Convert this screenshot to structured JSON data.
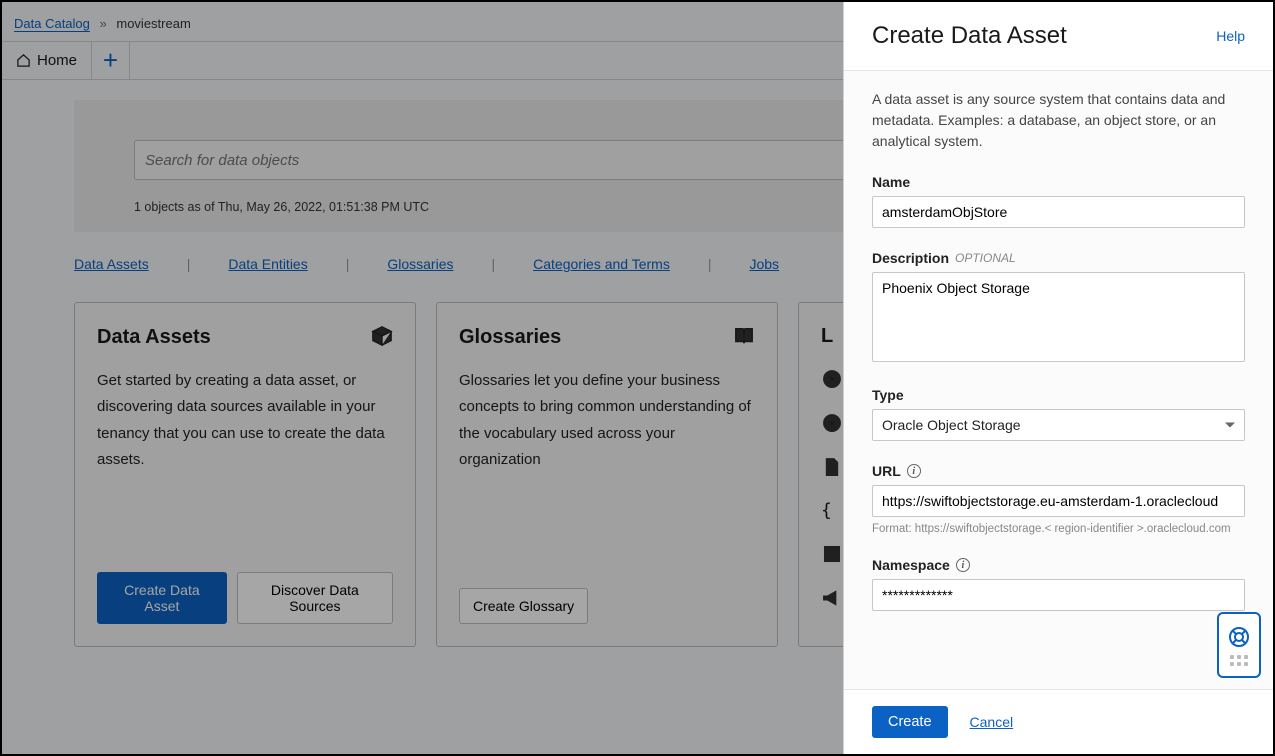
{
  "breadcrumb": {
    "root": "Data Catalog",
    "current": "moviestream"
  },
  "tabs": {
    "home": "Home"
  },
  "search": {
    "placeholder": "Search for data objects",
    "meta": "1 objects as of Thu, May 26, 2022, 01:51:38 PM UTC"
  },
  "nav": {
    "assets": "Data Assets",
    "entities": "Data Entities",
    "glossaries": "Glossaries",
    "categories": "Categories and Terms",
    "jobs": "Jobs"
  },
  "cards": {
    "assets": {
      "title": "Data Assets",
      "body": "Get started by creating a data asset, or discovering data sources available in your tenancy that you can use to create the data assets.",
      "create": "Create Data Asset",
      "discover": "Discover Data Sources"
    },
    "glossaries": {
      "title": "Glossaries",
      "body": "Glossaries let you define your business concepts to bring common understanding of the vocabulary used across your organization",
      "create": "Create Glossary"
    },
    "partial": {
      "title_fragment": "L"
    }
  },
  "panel": {
    "title": "Create Data Asset",
    "help": "Help",
    "intro": "A data asset is any source system that contains data and metadata. Examples: a database, an object store, or an analytical system.",
    "name_label": "Name",
    "name_value": "amsterdamObjStore",
    "desc_label": "Description",
    "optional": "OPTIONAL",
    "desc_value": "Phoenix Object Storage",
    "type_label": "Type",
    "type_value": "Oracle Object Storage",
    "url_label": "URL",
    "url_value": "https://swiftobjectstorage.eu-amsterdam-1.oraclecloud",
    "url_hint": "Format: https://swiftobjectstorage.< region-identifier >.oraclecloud.com",
    "namespace_label": "Namespace",
    "namespace_value": "*************",
    "create": "Create",
    "cancel": "Cancel"
  }
}
